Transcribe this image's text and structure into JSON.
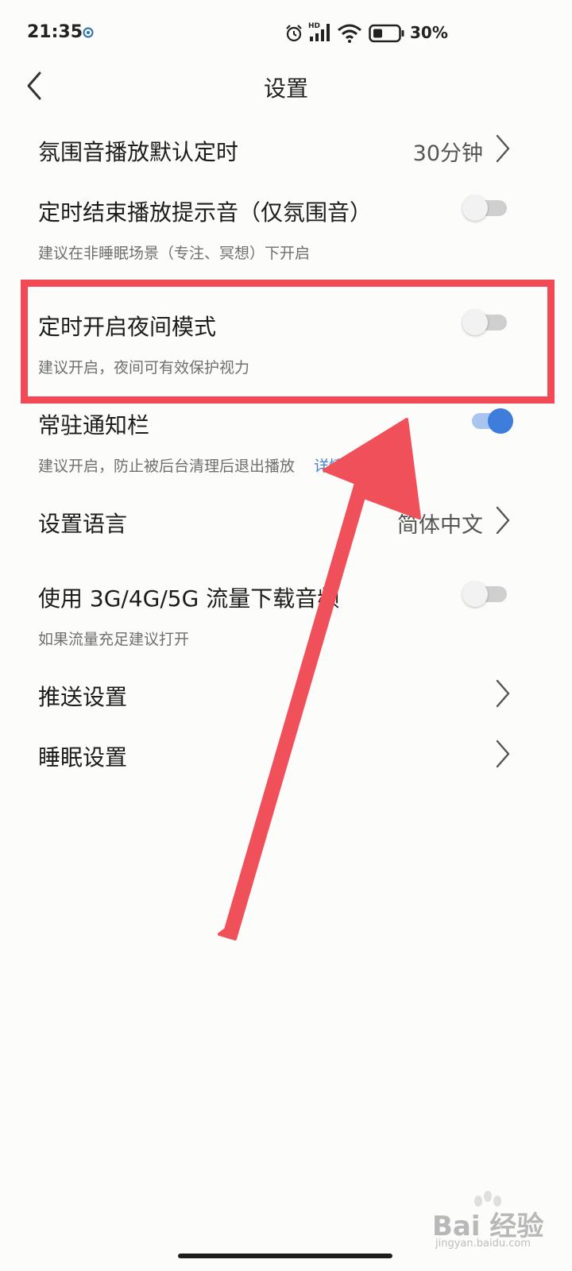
{
  "status_bar": {
    "time": "21:35",
    "network_label": "HD",
    "battery": "30%"
  },
  "header": {
    "title": "设置"
  },
  "settings": {
    "sleep_timer": {
      "title": "氛围音播放默认定时",
      "value": "30分钟"
    },
    "end_tone": {
      "title": "定时结束播放提示音（仅氛围音）",
      "subtitle": "建议在非睡眠场景（专注、冥想）下开启",
      "enabled": false
    },
    "night_mode": {
      "title": "定时开启夜间模式",
      "subtitle": "建议开启，夜间可有效保护视力",
      "enabled": false
    },
    "notification": {
      "title": "常驻通知栏",
      "subtitle": "建议开启，防止被后台清理后退出播放",
      "link": "详情",
      "enabled": true
    },
    "language": {
      "title": "设置语言",
      "value": "简体中文"
    },
    "mobile_data": {
      "title": "使用 3G/4G/5G 流量下载音频",
      "subtitle": "如果流量充足建议打开",
      "enabled": false
    },
    "push": {
      "title": "推送设置"
    },
    "sleep": {
      "title": "睡眠设置"
    }
  },
  "colors": {
    "highlight": "#f14a55",
    "toggle_on": "#3f7ddc",
    "link": "#4a7fd0"
  },
  "watermark": {
    "text": "Bai 经验",
    "sub": "jingyan.baidu.com"
  }
}
